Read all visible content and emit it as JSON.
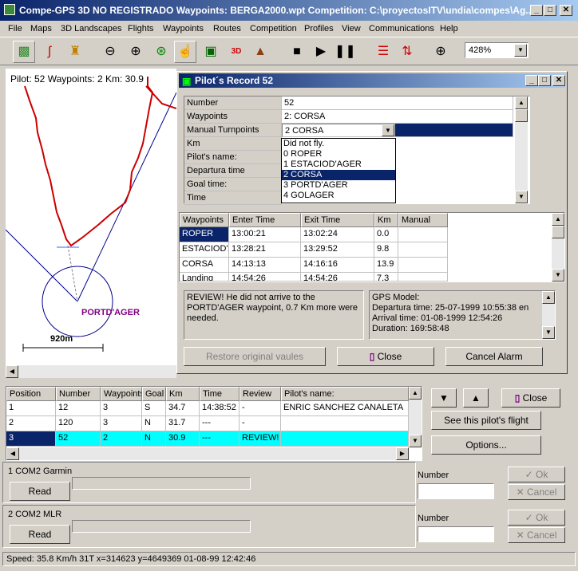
{
  "window": {
    "title": "Compe-GPS 3D NO REGISTRADO  Waypoints: BERGA2000.wpt   Competition: C:\\proyectosITV\\undia\\compes\\Ag..."
  },
  "menu": [
    "File",
    "Maps",
    "3D Landscapes",
    "Flights",
    "Waypoints",
    "Routes",
    "Competition",
    "Profiles",
    "View",
    "Communications",
    "Help"
  ],
  "toolbar": {
    "zoom": "428%",
    "icons": [
      "map-icon",
      "trace-icon",
      "landscape-icon",
      "zoom-out-icon",
      "zoom-in-icon",
      "zoom-fit-icon",
      "pointer-icon",
      "screen-icon",
      "3d-icon",
      "terrain-icon",
      "stop-icon",
      "play-icon",
      "pause-icon",
      "list-icon",
      "route-icon",
      "target-icon"
    ]
  },
  "map": {
    "info": "Pilot: 52  Waypoints: 2  Km: 30.9",
    "waypoint_label": "PORTD'AGER",
    "scale_label": "920m"
  },
  "dialog": {
    "title": "Pilot´s Record  52",
    "fields": [
      {
        "label": "Number",
        "value": "52"
      },
      {
        "label": "Waypoints",
        "value": "2: CORSA"
      },
      {
        "label": "Manual Turnpoints",
        "value": "2  CORSA"
      },
      {
        "label": "Km",
        "value": ""
      },
      {
        "label": "Pilot's name:",
        "value": ""
      },
      {
        "label": "Departura time",
        "value": ""
      },
      {
        "label": "Goal time:",
        "value": ""
      },
      {
        "label": "Time",
        "value": ""
      }
    ],
    "dropdown_options": [
      "Did not fly.",
      "0  ROPER",
      "1  ESTACIOD'AGER",
      "2  CORSA",
      "3  PORTD'AGER",
      "4  GOLAGER"
    ],
    "dropdown_selected_index": 3,
    "wp_headers": [
      "Waypoints",
      "Enter Time",
      "Exit Time",
      "Km",
      "Manual"
    ],
    "wp_rows": [
      {
        "wp": "ROPER",
        "enter": "13:00:21",
        "exit": "13:02:24",
        "km": "0.0",
        "manual": ""
      },
      {
        "wp": "ESTACIOD'AGER",
        "enter": "13:28:21",
        "exit": "13:29:52",
        "km": "9.8",
        "manual": ""
      },
      {
        "wp": "CORSA",
        "enter": "14:13:13",
        "exit": "14:16:16",
        "km": "13.9",
        "manual": ""
      },
      {
        "wp": "Landing",
        "enter": "14:54:26",
        "exit": "14:54:26",
        "km": "7.3",
        "manual": ""
      }
    ],
    "review_text": "REVIEW! He did not arrive to the PORTD'AGER waypoint,  0.7 Km more were needed.",
    "gps_model": {
      "title": "GPS Model:",
      "departure": "Departura time: 25-07-1999   10:55:38 en",
      "arrival": "Arrival time: 01-08-1999   12:54:26",
      "duration": "Duration: 169:58:48"
    },
    "restore_button": "Restore original vaules",
    "close_button": "Close",
    "cancel_alarm_button": "Cancel Alarm"
  },
  "results": {
    "headers": [
      "Position",
      "Number",
      "Waypoints",
      "Goal",
      "Km",
      "Time",
      "Review",
      "Pilot's name:"
    ],
    "rows": [
      {
        "pos": "1",
        "num": "12",
        "wp": "3",
        "goal": "S",
        "km": "34.7",
        "time": "14:38:52",
        "review": "-",
        "name": "ENRIC SANCHEZ CANALETA"
      },
      {
        "pos": "2",
        "num": "120",
        "wp": "3",
        "goal": "N",
        "km": "31.7",
        "time": "---",
        "review": "-",
        "name": ""
      },
      {
        "pos": "3",
        "num": "52",
        "wp": "2",
        "goal": "N",
        "km": "30.9",
        "time": "---",
        "review": "REVIEW!",
        "name": ""
      }
    ],
    "selected_row": 2
  },
  "side": {
    "close_button": "Close",
    "see_flight_button": "See this pilot's flight",
    "options_button": "Options..."
  },
  "com1": {
    "label": "1  COM2   Garmin",
    "read_button": "Read",
    "number_label": "Number",
    "ok_button": "Ok",
    "cancel_button": "Cancel"
  },
  "com2": {
    "label": "2  COM2   MLR",
    "read_button": "Read",
    "number_label": "Number",
    "ok_button": "Ok",
    "cancel_button": "Cancel"
  },
  "statusbar": {
    "text": "Speed: 35.8 Km/h 31T  x=314623  y=4649369 01-08-99 12:42:46"
  },
  "colors": {
    "title_blue": "#0a246a",
    "track_red": "#cc0000",
    "highlight_cyan": "#00ffff",
    "waypoint_purple": "#800080"
  }
}
